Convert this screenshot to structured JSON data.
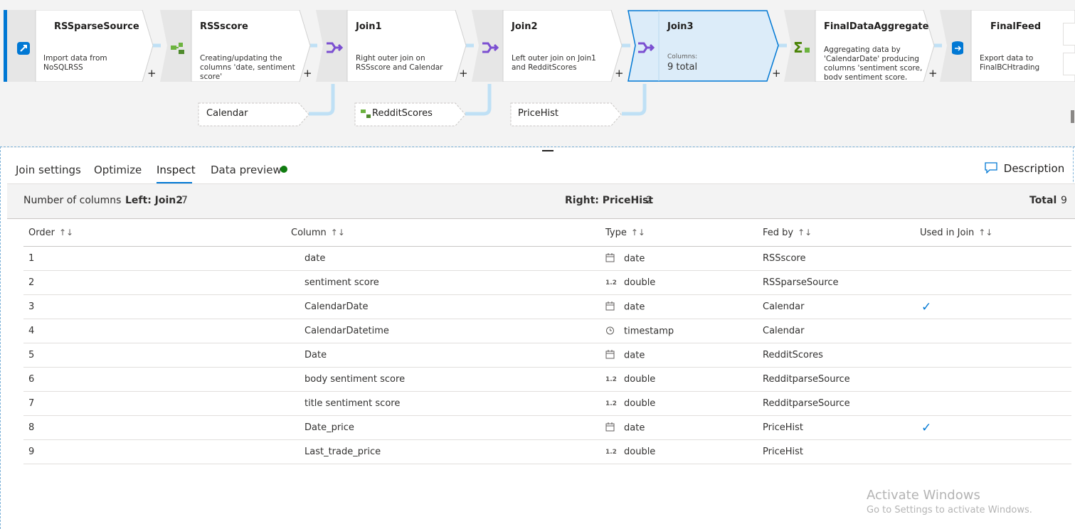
{
  "flow": {
    "nodes": [
      {
        "title": "RSSparseSource",
        "desc": "Import data from NoSQLRSS"
      },
      {
        "title": "RSSscore",
        "desc": "Creating/updating the columns 'date, sentiment score'"
      },
      {
        "title": "Join1",
        "desc": "Right outer join on RSSscore and Calendar"
      },
      {
        "title": "Join2",
        "desc": "Left outer join on Join1 and RedditScores"
      },
      {
        "title": "Join3",
        "columns_label": "Columns:",
        "columns_value": "9 total"
      },
      {
        "title": "FinalDataAggregate",
        "desc": "Aggregating data by 'CalendarDate' producing columns 'sentiment score, body sentiment score, title"
      },
      {
        "title": "FinalFeed",
        "desc": "Export data to FinalBCHtrading"
      }
    ],
    "sub_nodes": [
      "Calendar",
      "RedditScores",
      "PriceHist"
    ],
    "plus": "+"
  },
  "tabs": [
    {
      "label": "Join settings"
    },
    {
      "label": "Optimize"
    },
    {
      "label": "Inspect"
    },
    {
      "label": "Data preview"
    }
  ],
  "active_tab": "Inspect",
  "description_button": "Description",
  "summary": {
    "label": "Number of columns",
    "left_label": "Left: Join2",
    "left_value": "7",
    "right_label": "Right: PriceHist",
    "right_value": "2",
    "total_label": "Total",
    "total_value": "9"
  },
  "table": {
    "headers": [
      "Order",
      "Column",
      "Type",
      "Fed by",
      "Used in Join"
    ],
    "rows": [
      {
        "order": "1",
        "column": "date",
        "type": "date",
        "type_icon": "calendar-icon",
        "fed_by": "RSSscore",
        "used": false
      },
      {
        "order": "2",
        "column": "sentiment score",
        "type": "double",
        "type_icon": "1.2",
        "fed_by": "RSSparseSource",
        "used": false
      },
      {
        "order": "3",
        "column": "CalendarDate",
        "type": "date",
        "type_icon": "calendar-icon",
        "fed_by": "Calendar",
        "used": true
      },
      {
        "order": "4",
        "column": "CalendarDatetime",
        "type": "timestamp",
        "type_icon": "clock-icon",
        "fed_by": "Calendar",
        "used": false
      },
      {
        "order": "5",
        "column": "Date",
        "type": "date",
        "type_icon": "calendar-icon",
        "fed_by": "RedditScores",
        "used": false
      },
      {
        "order": "6",
        "column": "body sentiment score",
        "type": "double",
        "type_icon": "1.2",
        "fed_by": "RedditparseSource",
        "used": false
      },
      {
        "order": "7",
        "column": "title sentiment score",
        "type": "double",
        "type_icon": "1.2",
        "fed_by": "RedditparseSource",
        "used": false
      },
      {
        "order": "8",
        "column": "Date_price",
        "type": "date",
        "type_icon": "calendar-icon",
        "fed_by": "PriceHist",
        "used": true
      },
      {
        "order": "9",
        "column": "Last_trade_price",
        "type": "double",
        "type_icon": "1.2",
        "fed_by": "PriceHist",
        "used": false
      }
    ]
  },
  "watermark": {
    "line1": "Activate Windows",
    "line2": "Go to Settings to activate Windows."
  },
  "colors": {
    "accent": "#0078d4",
    "selected_fill": "#dcecf9",
    "status_green": "#107c10"
  }
}
